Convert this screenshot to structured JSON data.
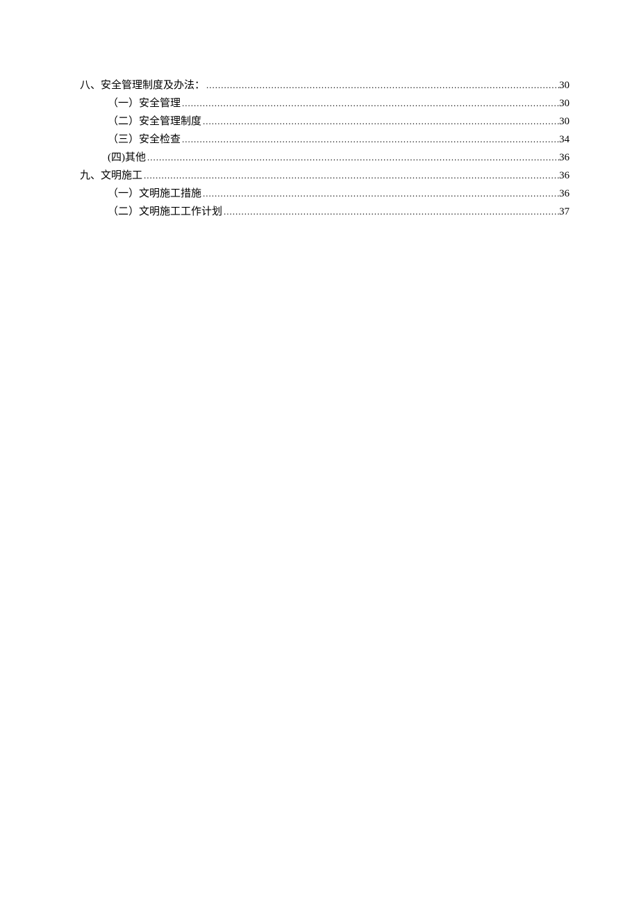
{
  "toc": [
    {
      "level": 1,
      "title": "八、安全管理制度及办法：",
      "page": "30"
    },
    {
      "level": 2,
      "title": "（一）安全管理",
      "page": "30"
    },
    {
      "level": 2,
      "title": "（二）安全管理制度",
      "page": "30"
    },
    {
      "level": 2,
      "title": "（三）安全检查",
      "page": "34"
    },
    {
      "level": 2,
      "title": "(四)其他",
      "page": "36"
    },
    {
      "level": 1,
      "title": "九、文明施工",
      "page": "36"
    },
    {
      "level": 2,
      "title": "（一）文明施工措施",
      "page": "36"
    },
    {
      "level": 2,
      "title": "（二）文明施工工作计划",
      "page": "37"
    }
  ]
}
